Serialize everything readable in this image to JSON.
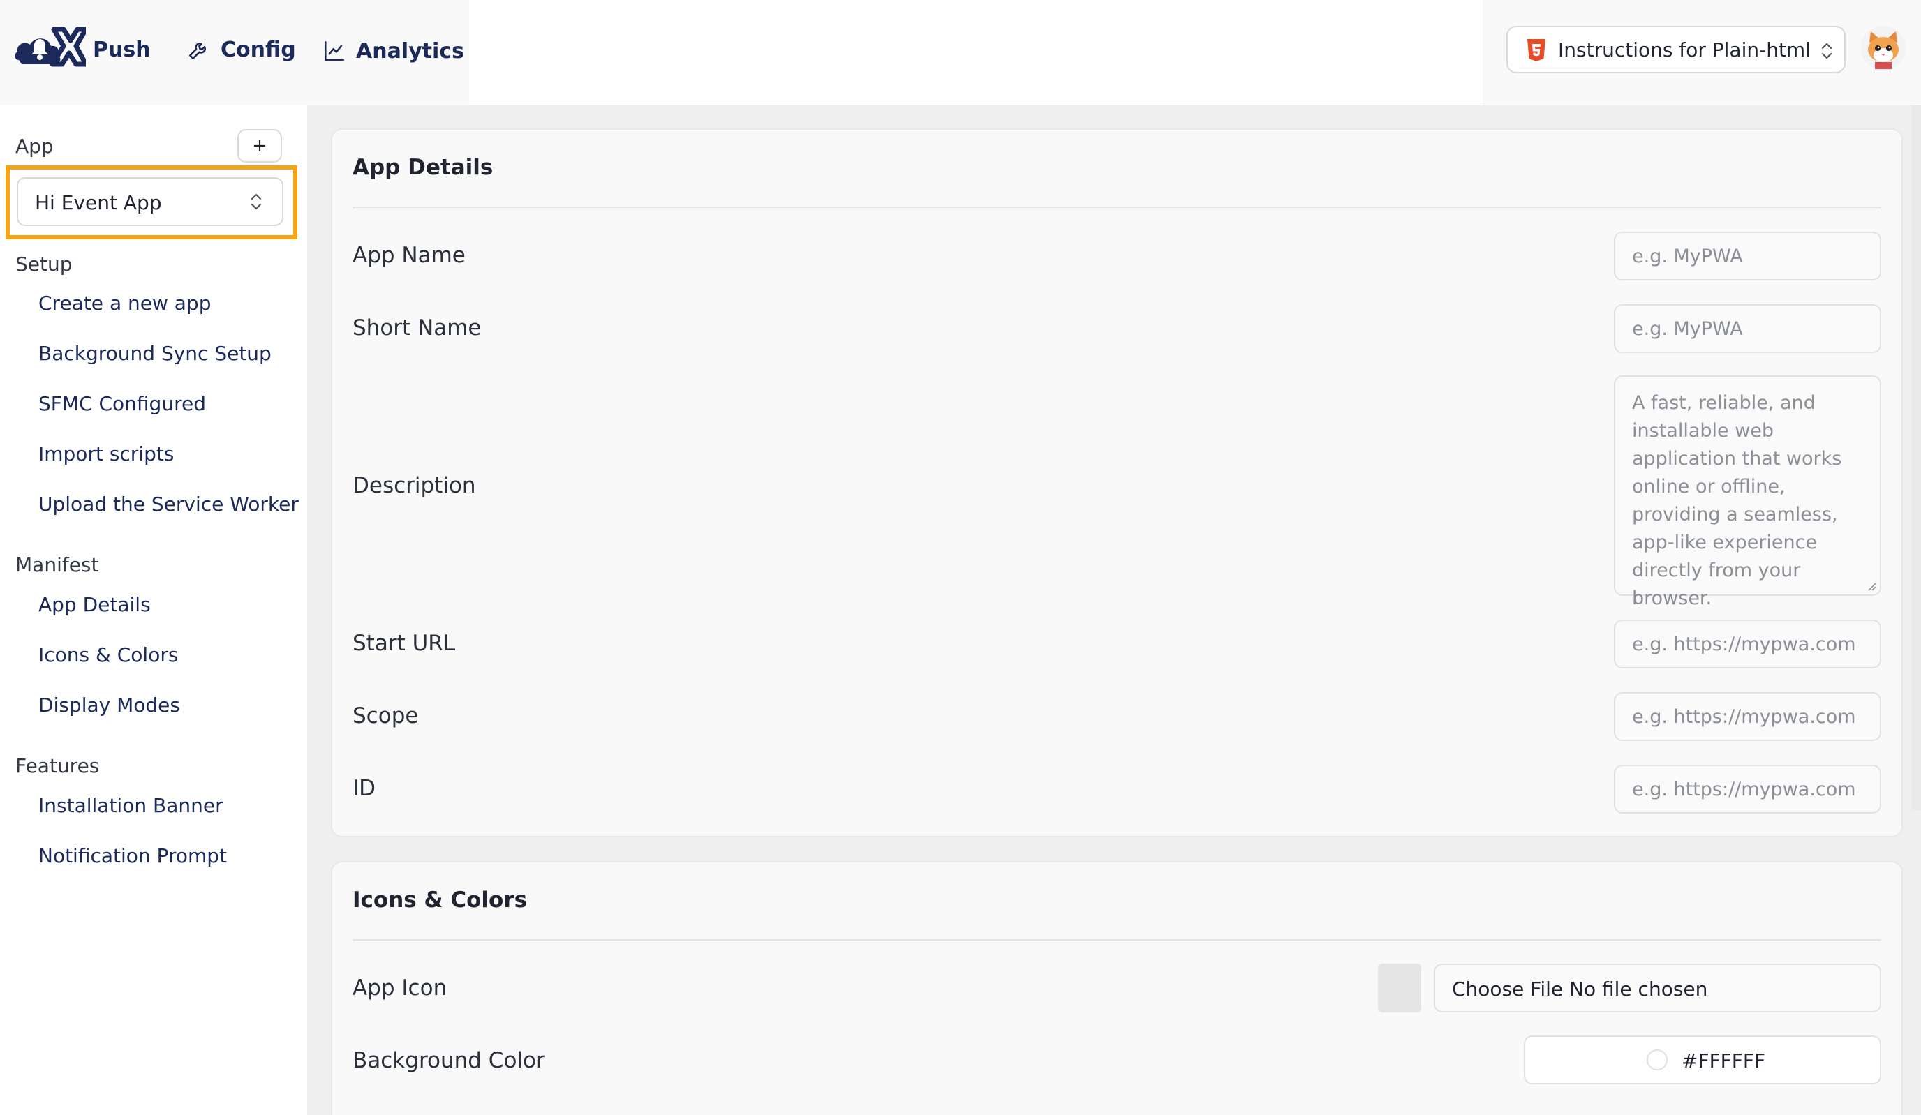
{
  "nav": {
    "push_label": "Push",
    "config_label": "Config",
    "analytics_label": "Analytics",
    "instructions_select_value": "Instructions for Plain-html"
  },
  "sidebar": {
    "app_label": "App",
    "add_button_label": "+",
    "app_select_value": "Hi Event App",
    "sections": [
      {
        "label": "Setup",
        "items": [
          "Create a new app",
          "Background Sync Setup",
          "SFMC Configured",
          "Import scripts",
          "Upload the Service Worker"
        ]
      },
      {
        "label": "Manifest",
        "items": [
          "App Details",
          "Icons & Colors",
          "Display Modes"
        ]
      },
      {
        "label": "Features",
        "items": [
          "Installation Banner",
          "Notification Prompt"
        ]
      }
    ]
  },
  "app_details": {
    "title": "App Details",
    "fields": [
      {
        "label": "App Name",
        "placeholder": "e.g. MyPWA"
      },
      {
        "label": "Short Name",
        "placeholder": "e.g. MyPWA"
      },
      {
        "label": "Description",
        "placeholder": "A fast, reliable, and installable web application that works online or offline, providing a seamless, app-like experience directly from your browser."
      },
      {
        "label": "Start URL",
        "placeholder": "e.g. https://mypwa.com"
      },
      {
        "label": "Scope",
        "placeholder": "e.g. https://mypwa.com"
      },
      {
        "label": "ID",
        "placeholder": "e.g. https://mypwa.com"
      }
    ]
  },
  "icons_colors": {
    "title": "Icons & Colors",
    "app_icon_label": "App Icon",
    "file_input_text": "Choose File No file chosen",
    "background_color_label": "Background Color",
    "background_color_value": "#FFFFFF"
  },
  "colors": {
    "brand_navy": "#1b2a5a",
    "highlight_orange": "#f5a413",
    "html5_orange": "#e44d26"
  }
}
